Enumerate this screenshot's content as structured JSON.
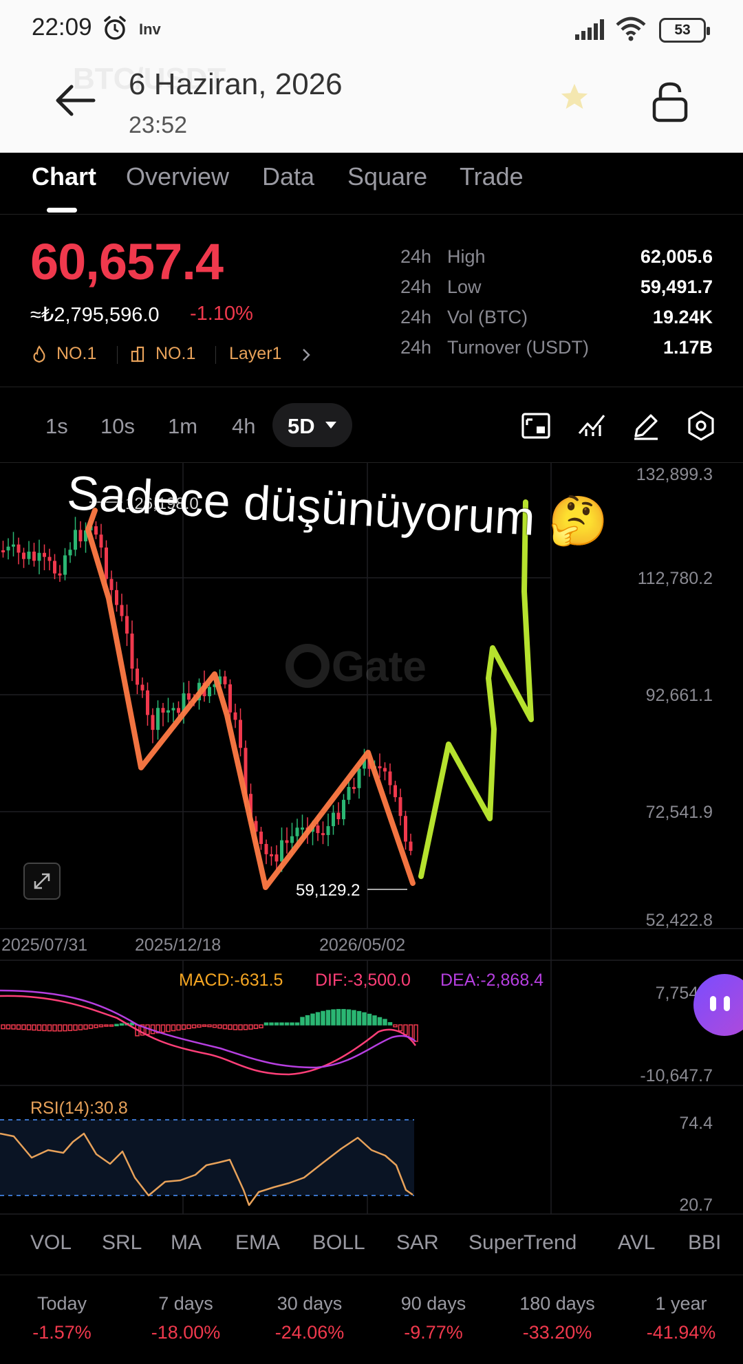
{
  "status_bar": {
    "time": "22:09",
    "carrier": "Inv",
    "battery": "53"
  },
  "header": {
    "date": "6 Haziran, 2026",
    "time": "23:52",
    "ghost_pair": "BTC/USDT"
  },
  "tabs": [
    {
      "label": "Chart"
    },
    {
      "label": "Overview"
    },
    {
      "label": "Data"
    },
    {
      "label": "Square"
    },
    {
      "label": "Trade"
    }
  ],
  "price": {
    "last": "60,657.4",
    "converted": "≈₺2,795,596.0",
    "change": "-1.10%",
    "tags": [
      "NO.1",
      "NO.1",
      "Layer1"
    ]
  },
  "stats": [
    {
      "prefix": "24h",
      "label": "High",
      "value": "62,005.6"
    },
    {
      "prefix": "24h",
      "label": "Low",
      "value": "59,491.7"
    },
    {
      "prefix": "24h",
      "label": "Vol (BTC)",
      "value": "19.24K"
    },
    {
      "prefix": "24h",
      "label": "Turnover (USDT)",
      "value": "1.17B"
    }
  ],
  "timeframes": [
    "1s",
    "10s",
    "1m",
    "4h",
    "5D"
  ],
  "active_timeframe": "5D",
  "overlay_text": "Sadece düşünüyorum 🤔",
  "watermark": "Gate",
  "chart": {
    "y_labels": [
      "132,899.3",
      "112,780.2",
      "92,661.1",
      "72,541.9",
      "52,422.8"
    ],
    "x_labels": [
      "2025/07/31",
      "2025/12/18",
      "2026/05/02"
    ],
    "high_marker": "126,198.0",
    "low_marker": "59,129.2"
  },
  "macd": {
    "macd": "MACD:-631.5",
    "dif": "DIF:-3,500.0",
    "dea": "DEA:-2,868.4",
    "y_top": "7,754.8",
    "y_bottom": "-10,647.7"
  },
  "rsi": {
    "label": "RSI(14):30.8",
    "y_top": "74.4",
    "y_bottom": "20.7"
  },
  "indicators": [
    "VOL",
    "SRL",
    "MA",
    "EMA",
    "BOLL",
    "SAR",
    "SuperTrend",
    "AVL",
    "BBI"
  ],
  "performance": [
    {
      "period": "Today",
      "value": "-1.57%"
    },
    {
      "period": "7 days",
      "value": "-18.00%"
    },
    {
      "period": "30 days",
      "value": "-24.06%"
    },
    {
      "period": "90 days",
      "value": "-9.77%"
    },
    {
      "period": "180 days",
      "value": "-33.20%"
    },
    {
      "period": "1 year",
      "value": "-41.94%"
    }
  ],
  "colors": {
    "down": "#f0394d",
    "up": "#2bb673",
    "accent": "#e8a25a",
    "macd": "#f5a623",
    "dif": "#ff3f78",
    "dea": "#b63fe0",
    "orange_drawing": "#ff7a45",
    "green_drawing": "#b6e22e"
  }
}
